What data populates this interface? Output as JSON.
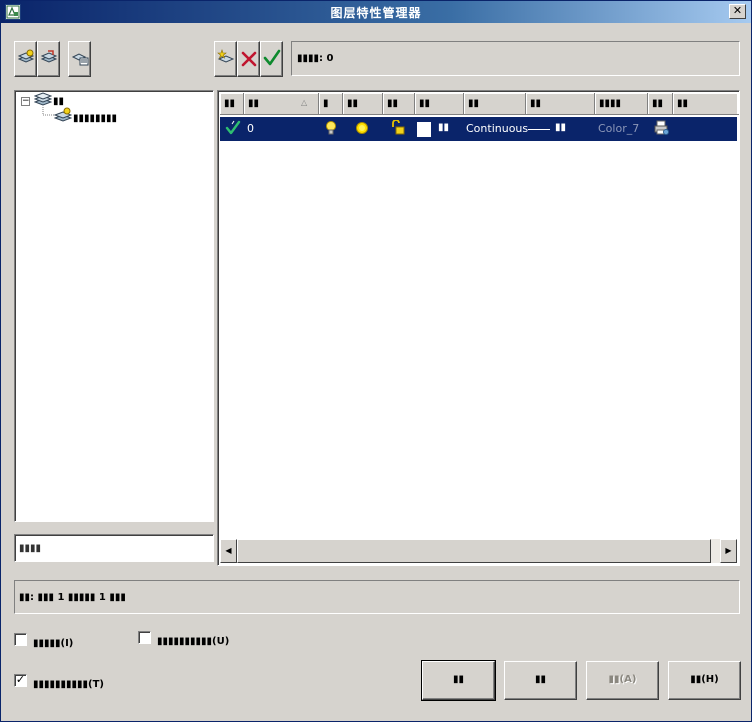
{
  "window": {
    "title": "图层特性管理器",
    "close_label": "✕"
  },
  "toolbar": {
    "left_icons": [
      "new-property-filter-icon",
      "new-group-filter-icon",
      "layer-states-manager-icon"
    ],
    "right_icons": [
      "new-layer-icon",
      "delete-layer-icon",
      "set-current-icon"
    ],
    "status_text": "▮▮▮▮: 0"
  },
  "tree": {
    "root_label": "▮▮",
    "child_label": "▮▮▮▮▮▮▮▮",
    "expander": "−"
  },
  "search": {
    "value": "▮▮▮▮"
  },
  "layer_table": {
    "columns": [
      "▮▮",
      "▮▮",
      "▮",
      "▮▮",
      "▮▮",
      "▮▮",
      "▮▮",
      "▮▮",
      "▮▮▮▮",
      "▮▮",
      "▮▮"
    ],
    "sort_indicator": "△",
    "rows": [
      {
        "status_icon": "current-layer-check-icon",
        "name": "0",
        "on_icon": "lightbulb-on-icon",
        "freeze_icon": "sun-thawed-icon",
        "lock_icon": "unlocked-padlock-icon",
        "color_label": "▮▮",
        "linetype": "Continuous",
        "lineweight": "▮▮",
        "plot_style": "Color_7",
        "plot_icon": "printer-icon"
      }
    ]
  },
  "summary_text": "▮▮: ▮▮▮ 1 ▮▮▮▮▮ 1 ▮▮▮",
  "options": {
    "invert_filter": {
      "label": "▮▮▮▮▮(I)",
      "checked": false
    },
    "apply_toolbar": {
      "label": "▮▮▮▮▮▮▮▮▮▮(U)",
      "checked": false
    },
    "show_used": {
      "label": "▮▮▮▮▮▮▮▮▮▮(T)",
      "checked": true
    }
  },
  "buttons": {
    "ok": "▮▮",
    "cancel": "▮▮",
    "apply": "▮▮(A)",
    "help": "▮▮(H)"
  }
}
